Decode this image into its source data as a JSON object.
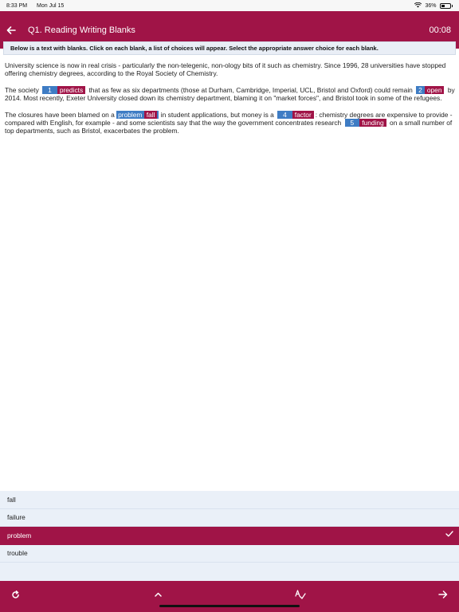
{
  "status_bar": {
    "time": "8:33 PM",
    "date": "Mon Jul 15",
    "battery": "36%"
  },
  "header": {
    "title": "Q1. Reading Writing Blanks",
    "timer": "00:08"
  },
  "instruction": "Below is a text with blanks. Click on each blank, a list of choices will appear. Select the appropriate answer choice for each blank.",
  "passage": {
    "p1": "University science is now in real crisis - particularly the non-telegenic, non-ology bits of it such as chemistry. Since 1996, 28 universities have stopped offering chemistry degrees, according to the Royal Society of Chemistry.",
    "p2_a": "The society",
    "p2_b": "that as few as six departments (those at Durham, Cambridge, Imperial, UCL, Bristol and Oxford) could remain",
    "p2_c": "by 2014. Most recently, Exeter University closed down its chemistry department, blaming it on \"market forces\", and Bristol took in some of the refugees.",
    "p3_a": "The closures have been blamed on a",
    "p3_b": "in student applications, but money is a",
    "p3_c": ": chemistry degrees are expensive to provide - compared with English, for example - and some scientists say that the way the government concentrates research",
    "p3_d": "on a small number of top departments, such as Bristol, exacerbates the problem.",
    "blanks": [
      {
        "num": "1",
        "answer": "predicts"
      },
      {
        "num": "2",
        "answer": "open"
      },
      {
        "num": "3",
        "selected": "problem",
        "answer": "fall"
      },
      {
        "num": "4",
        "answer": "factor"
      },
      {
        "num": "5",
        "answer": "funding"
      }
    ]
  },
  "choices": [
    "fall",
    "failure",
    "problem",
    "trouble"
  ],
  "selected_choice": "problem",
  "icons": {
    "back": "arrow-left-icon",
    "refresh": "refresh-icon",
    "collapse": "chevron-up-icon",
    "spellcheck": "spellcheck-icon",
    "next": "arrow-right-icon",
    "check": "checkmark-icon"
  },
  "colors": {
    "brand": "#a01447",
    "blank_blue": "#3e7cc4",
    "choices_bg": "#eaf0f8"
  }
}
